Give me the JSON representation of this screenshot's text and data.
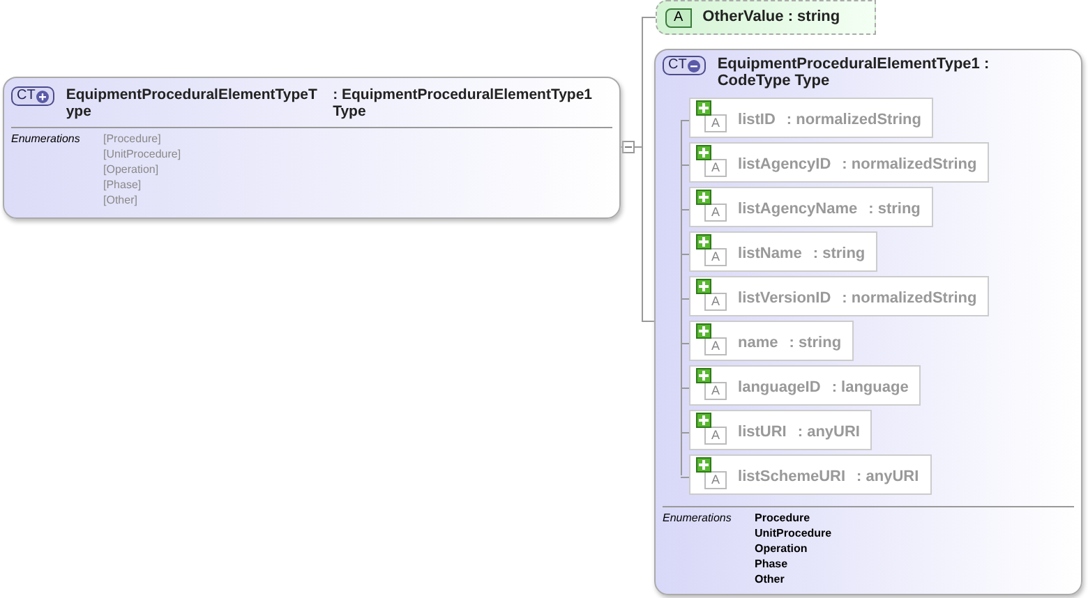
{
  "complex_type": {
    "badge": "CT",
    "expanded": false,
    "name": "EquipmentProceduralElementTypeT ype",
    "type": ": EquipmentProceduralElementType1 Type",
    "enumerations_label": "Enumerations",
    "enumerations": [
      "[Procedure]",
      "[UnitProcedure]",
      "[Operation]",
      "[Phase]",
      "[Other]"
    ]
  },
  "attribute": {
    "badge": "A",
    "name": "OtherValue",
    "type": ": string"
  },
  "base_type": {
    "badge": "CT",
    "expanded": true,
    "name": "EquipmentProceduralElementType1",
    "type": ": CodeType Type",
    "attributes": [
      {
        "badge": "A",
        "name": "listID",
        "type": ": normalizedString"
      },
      {
        "badge": "A",
        "name": "listAgencyID",
        "type": ": normalizedString"
      },
      {
        "badge": "A",
        "name": "listAgencyName",
        "type": ": string"
      },
      {
        "badge": "A",
        "name": "listName",
        "type": ": string"
      },
      {
        "badge": "A",
        "name": "listVersionID",
        "type": ": normalizedString"
      },
      {
        "badge": "A",
        "name": "name",
        "type": ": string"
      },
      {
        "badge": "A",
        "name": "languageID",
        "type": ": language"
      },
      {
        "badge": "A",
        "name": "listURI",
        "type": ": anyURI"
      },
      {
        "badge": "A",
        "name": "listSchemeURI",
        "type": ": anyURI"
      }
    ],
    "enumerations_label": "Enumerations",
    "enumerations": [
      "Procedure",
      "UnitProcedure",
      "Operation",
      "Phase",
      "Other"
    ]
  }
}
